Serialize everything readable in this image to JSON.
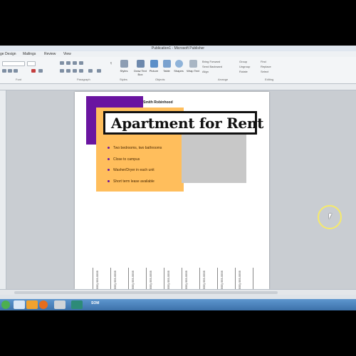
{
  "window": {
    "title": "Publication1 - Microsoft Publisher"
  },
  "tabs": [
    "ge Design",
    "Mailings",
    "Review",
    "View"
  ],
  "ribbon": {
    "groups": [
      "Font",
      "Paragraph",
      "Styles",
      "Objects",
      "Arrange",
      "Editing"
    ],
    "buttons": {
      "styles": "Styles",
      "draw_text_box": "Draw Text Box",
      "picture": "Picture",
      "table": "Table",
      "shapes": "Shapes",
      "wrap_text": "Wrap Text",
      "bring_forward": "Bring Forward",
      "send_backward": "Send Backward",
      "align": "Align",
      "group": "Group",
      "ungroup": "Ungroup",
      "rotate": "Rotate",
      "find": "Find",
      "replace": "Replace",
      "select": "Select"
    }
  },
  "document": {
    "company": "Smith Robinhood",
    "headline": "Apartment for Rent",
    "bullets": [
      "Two bedrooms, two bathrooms",
      "Close to campus",
      "Washer/Dryer in each unit",
      "Short term lease available"
    ],
    "tear_off_text": "Contact Info\n(555) 555-5555"
  },
  "taskbar": {
    "label": "SOM"
  },
  "colors": {
    "purple": "#6a14a0",
    "yellow": "#ffbe5c",
    "gray": "#c8c8c8",
    "taskbar": "#3c71aa"
  }
}
